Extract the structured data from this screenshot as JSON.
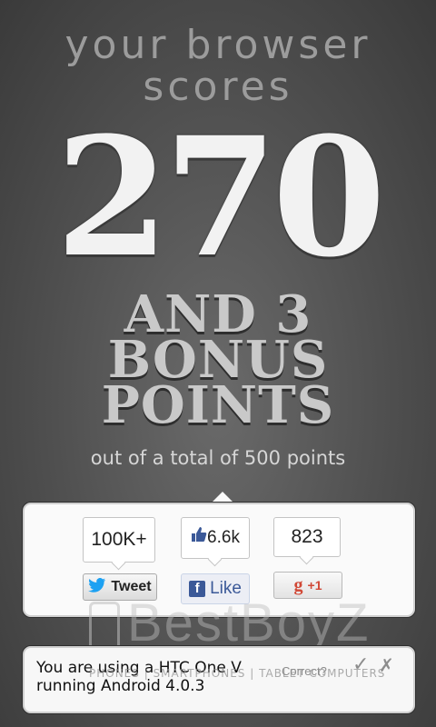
{
  "headline": {
    "line1": "your browser",
    "line2": "scores"
  },
  "score": "270",
  "bonus": {
    "line1": "AND 3",
    "line2": "BONUS",
    "line3": "POINTS"
  },
  "total_text": "out of a total of 500 points",
  "share": {
    "twitter": {
      "count": "100K+",
      "label": "Tweet"
    },
    "facebook": {
      "count": "6.6k",
      "label": "Like"
    },
    "google": {
      "count": "823",
      "label": "+1"
    }
  },
  "watermark": {
    "title": "BestBoyZ",
    "subtitle": "PHONES | SMARTPHONES | TABLET COMPUTERS"
  },
  "device": {
    "line1": "You are using a HTC One V",
    "line2": "running Android 4.0.3",
    "correct_label": "Correct?",
    "yes": "✓",
    "no": "✗"
  },
  "colors": {
    "twitter_blue": "#1da1f2",
    "facebook_blue": "#3b5998",
    "google_red": "#d14836"
  }
}
